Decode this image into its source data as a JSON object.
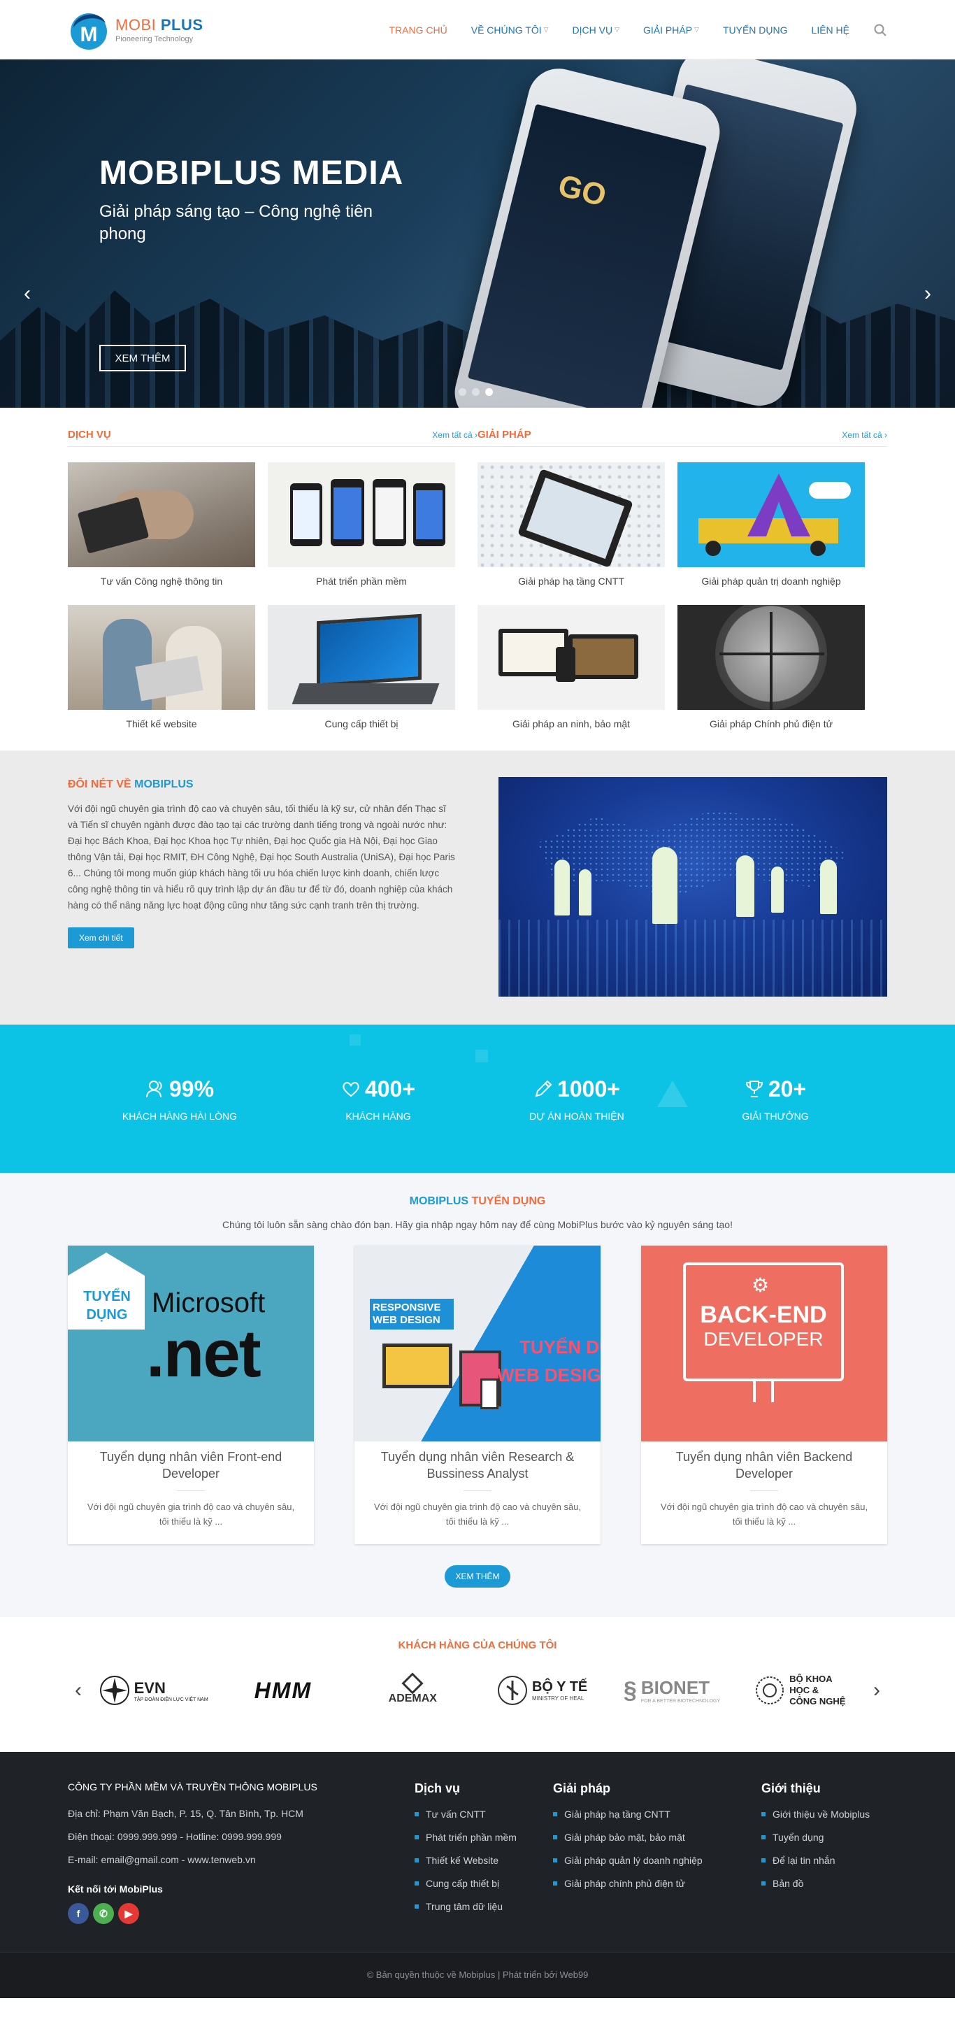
{
  "brand": {
    "name_part1": "MOBI",
    "name_part2": "PLUS",
    "tagline": "Pioneering Technology"
  },
  "nav": [
    {
      "label": "TRANG CHỦ",
      "active": true,
      "dropdown": false
    },
    {
      "label": "VỀ CHÚNG TÔI",
      "active": false,
      "dropdown": true
    },
    {
      "label": "DỊCH VỤ",
      "active": false,
      "dropdown": true
    },
    {
      "label": "GIẢI PHÁP",
      "active": false,
      "dropdown": true
    },
    {
      "label": "TUYỂN DỤNG",
      "active": false,
      "dropdown": false
    },
    {
      "label": "LIÊN HỆ",
      "active": false,
      "dropdown": false
    }
  ],
  "hero": {
    "title": "MOBIPLUS MEDIA",
    "subtitle": "Giải pháp sáng tạo – Công nghệ tiên phong",
    "button": "XEM THÊM",
    "phone_logo": "GO",
    "active_slide": 3,
    "slide_count": 3
  },
  "services": {
    "title": "DỊCH VỤ",
    "see_all": "Xem tất cả",
    "items": [
      {
        "label": "Tư vấn Công nghệ thông tin"
      },
      {
        "label": "Phát triển phần mềm"
      },
      {
        "label": "Thiết kế website"
      },
      {
        "label": "Cung cấp thiết bị"
      }
    ]
  },
  "solutions": {
    "title": "GIẢI PHÁP",
    "see_all": "Xem tất cả",
    "items": [
      {
        "label": "Giải pháp hạ tầng CNTT"
      },
      {
        "label": "Giải pháp quản trị doanh nghiệp"
      },
      {
        "label": "Giải pháp an ninh, bảo mật"
      },
      {
        "label": "Giải pháp Chính phủ điện tử"
      }
    ]
  },
  "about": {
    "title_part1": "ĐÔI NÉT VỀ",
    "title_part2": "MOBIPLUS",
    "body": "Với đội ngũ chuyên gia trình độ cao và chuyên sâu, tối thiểu là kỹ sư, cử nhân đến Thạc sĩ và Tiến sĩ chuyên ngành được đào tạo tại các trường danh tiếng trong và ngoài nước như: Đại học Bách Khoa, Đại học Khoa học Tự nhiên, Đại học Quốc gia Hà Nội, Đại học Giao thông Vận tải, Đại học RMIT, ĐH Công Nghệ, Đại học South Australia (UniSA), Đại học Paris 6... Chúng tôi mong muốn giúp khách hàng tối ưu hóa chiến lược kinh doanh, chiến lược công nghệ thông tin và hiểu rõ quy trình lập dự án đầu tư để từ đó, doanh nghiệp của khách hàng có thể nâng năng lực hoạt động cũng như tăng sức cạnh tranh trên thị trường.",
    "button": "Xem chi tiết"
  },
  "stats": [
    {
      "icon": "users-icon",
      "value": "99%",
      "label": "KHÁCH HÀNG HÀI LÒNG"
    },
    {
      "icon": "heart-icon",
      "value": "400+",
      "label": "KHÁCH HÀNG"
    },
    {
      "icon": "pencil-icon",
      "value": "1000+",
      "label": "DỰ ÁN HOÀN THIỆN"
    },
    {
      "icon": "trophy-icon",
      "value": "20+",
      "label": "GIẢI THƯỞNG"
    }
  ],
  "recruit": {
    "title_part1": "MOBIPLUS",
    "title_part2": "TUYỂN DỤNG",
    "subtitle": "Chúng tôi luôn sẵn sàng chào đón bạn. Hãy gia nhập ngay hôm nay để cùng MobiPlus bước vào kỷ nguyên sáng tạo!",
    "jobs": [
      {
        "title": "Tuyển dụng nhân viên Front-end Developer",
        "desc": "Với đội ngũ chuyên gia trình độ cao và chuyên sâu, tối thiểu là kỹ ...",
        "image_badge": "TUYỂN DỤNG",
        "image_text1": "Microsoft",
        "image_text2": ".net"
      },
      {
        "title": "Tuyển dụng nhân viên Research & Bussiness Analyst",
        "desc": "Với đội ngũ chuyên gia trình độ cao và chuyên sâu, tối thiểu là kỹ ...",
        "image_text1": "RESPONSIVE WEB DESIGN",
        "image_text2": "TUYỂN DỤNG",
        "image_text3": "WEB DESIGNER"
      },
      {
        "title": "Tuyển dụng nhân viên Backend Developer",
        "desc": "Với đội ngũ chuyên gia trình độ cao và chuyên sâu, tối thiểu là kỹ ...",
        "image_text1": "BACK-END",
        "image_text2": "DEVELOPER"
      }
    ],
    "button": "XEM THÊM"
  },
  "clients": {
    "title": "KHÁCH HÀNG CỦA CHÚNG TÔI",
    "logos": [
      {
        "name": "EVN",
        "sub": "TẬP ĐOÀN ĐIỆN LỰC VIỆT NAM"
      },
      {
        "name": "HMM"
      },
      {
        "name": "ADEMAX"
      },
      {
        "name": "BỘ Y TẾ",
        "sub": "MINISTRY OF HEAL"
      },
      {
        "name": "BIONET",
        "sub": "FOR A BETTER BIOTECHNOLOGY"
      },
      {
        "name": "BỘ KHOA HỌC & CÔNG NGHỆ"
      }
    ]
  },
  "footer": {
    "company": "CÔNG TY PHẦN MỀM VÀ TRUYỀN THÔNG MOBIPLUS",
    "address": "Địa chỉ: Phạm Văn Bạch, P. 15, Q. Tân Bình, Tp. HCM",
    "phone": "Điện thoại: 0999.999.999  - Hotline: 0999.999.999",
    "email": "E-mail: email@gmail.com - www.tenweb.vn",
    "connect": "Kết nối tới MobiPlus",
    "col1": {
      "title": "Dịch vụ",
      "items": [
        "Tư vấn CNTT",
        "Phát triển phần mềm",
        "Thiết kế Website",
        "Cung cấp thiết bị",
        "Trung tâm dữ liệu"
      ]
    },
    "col2": {
      "title": "Giải pháp",
      "items": [
        "Giải pháp hạ tầng CNTT",
        "Giải pháp bảo mật, bảo mật",
        "Giải pháp quản lý doanh nghiệp",
        "Giải pháp chính phủ điện tử"
      ]
    },
    "col3": {
      "title": "Giới thiệu",
      "items": [
        "Giới thiệu về Mobiplus",
        "Tuyển dụng",
        "Để lại tin nhắn",
        "Bản đồ"
      ]
    },
    "copyright": "© Bản quyền thuộc về Mobiplus  |  Phát triển bởi Web99"
  },
  "colors": {
    "orange": "#f26b3a",
    "blue": "#1b9ad6",
    "cyan": "#0cc3e6",
    "footer": "#1f2226"
  }
}
